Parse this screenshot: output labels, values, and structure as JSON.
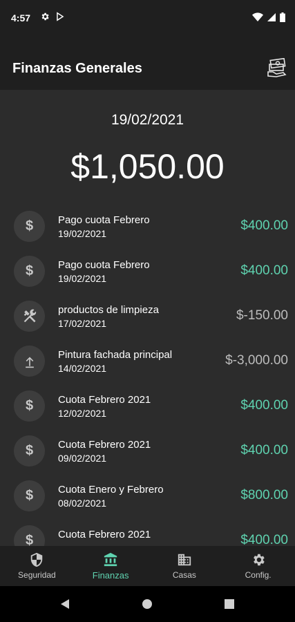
{
  "status": {
    "time": "4:57"
  },
  "appbar": {
    "title": "Finanzas Generales"
  },
  "summary": {
    "date": "19/02/2021",
    "amount": "$1,050.00"
  },
  "transactions": [
    {
      "icon": "dollar-icon",
      "title": "Pago cuota Febrero",
      "date": "19/02/2021",
      "amount": "$400.00",
      "kind": "income"
    },
    {
      "icon": "dollar-icon",
      "title": "Pago cuota Febrero",
      "date": "19/02/2021",
      "amount": "$400.00",
      "kind": "income"
    },
    {
      "icon": "tools-icon",
      "title": "productos de limpieza",
      "date": "17/02/2021",
      "amount": "$-150.00",
      "kind": "expense"
    },
    {
      "icon": "upload-icon",
      "title": "Pintura fachada principal",
      "date": "14/02/2021",
      "amount": "$-3,000.00",
      "kind": "expense"
    },
    {
      "icon": "dollar-icon",
      "title": "Cuota Febrero 2021",
      "date": "12/02/2021",
      "amount": "$400.00",
      "kind": "income"
    },
    {
      "icon": "dollar-icon",
      "title": "Cuota Febrero 2021",
      "date": "09/02/2021",
      "amount": "$400.00",
      "kind": "income"
    },
    {
      "icon": "dollar-icon",
      "title": "Cuota Enero y Febrero",
      "date": "08/02/2021",
      "amount": "$800.00",
      "kind": "income"
    },
    {
      "icon": "dollar-icon",
      "title": "Cuota Febrero 2021",
      "date": "",
      "amount": "$400.00",
      "kind": "income"
    }
  ],
  "bottom_nav": [
    {
      "label": "Seguridad",
      "icon": "shield-icon",
      "active": false
    },
    {
      "label": "Finanzas",
      "icon": "bank-icon",
      "active": true
    },
    {
      "label": "Casas",
      "icon": "building-icon",
      "active": false
    },
    {
      "label": "Config.",
      "icon": "gear-icon",
      "active": false
    }
  ],
  "colors": {
    "accent": "#5fd3b0",
    "background": "#2c2c2c",
    "bar": "#1f1f1f",
    "expense": "#bdbdbd"
  }
}
